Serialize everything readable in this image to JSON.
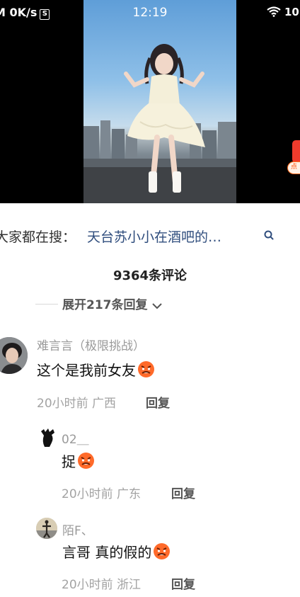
{
  "status_bar": {
    "left_text": "M 0K/s",
    "left_badge": "S",
    "time": "12:19",
    "right_text": "10"
  },
  "side_widget": {
    "label": "点"
  },
  "search_suggestion": {
    "prefix": "大家都在搜：",
    "query": "天台苏小小在酒吧的…"
  },
  "comments_header": {
    "count_label": "9364条评论",
    "expand_label": "展开217条回复"
  },
  "comments": [
    {
      "username": "难言言（极限挑战）",
      "text": "这个是我前女友",
      "emoji": "angry-face",
      "time": "20小时前",
      "location": "广西",
      "reply_label": "回复"
    },
    {
      "username": "02＿",
      "text": "捉",
      "emoji": "angry-face",
      "time": "20小时前",
      "location": "广东",
      "reply_label": "回复"
    },
    {
      "username": "陌F、",
      "text": "言哥 真的假的",
      "emoji": "angry-face",
      "time": "20小时前",
      "location": "浙江",
      "reply_label": "回复"
    }
  ],
  "colors": {
    "accent_link": "#2f4d7d",
    "secondary_text": "#9a9a9a",
    "widget_red": "#ef3b2c"
  }
}
